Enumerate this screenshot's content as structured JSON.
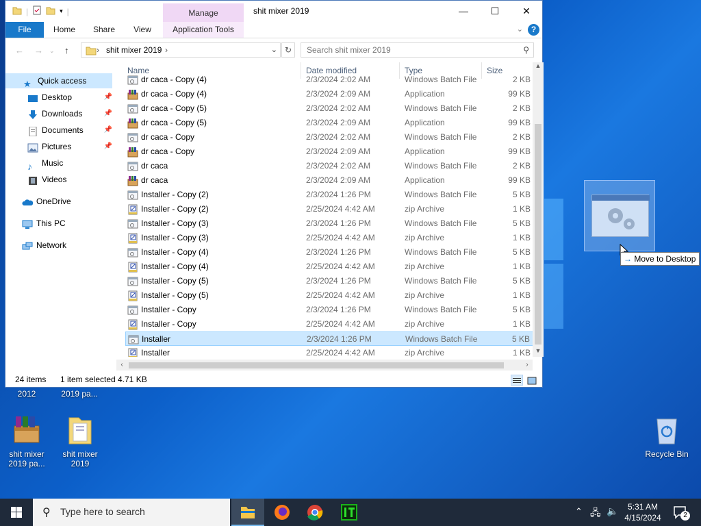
{
  "window": {
    "title": "shit mixer 2019",
    "context_tab": "Manage",
    "controls": {
      "minimize": "—",
      "maximize": "☐",
      "close": "✕"
    }
  },
  "ribbon": {
    "tabs": [
      "File",
      "Home",
      "Share",
      "View",
      "Application Tools"
    ],
    "help": "?"
  },
  "address": {
    "path": "shit mixer 2019",
    "search_placeholder": "Search shit mixer 2019"
  },
  "navpane": {
    "quick_access": "Quick access",
    "items": [
      "Desktop",
      "Downloads",
      "Documents",
      "Pictures",
      "Music",
      "Videos"
    ],
    "onedrive": "OneDrive",
    "thispc": "This PC",
    "network": "Network"
  },
  "columns": {
    "name": "Name",
    "date": "Date modified",
    "type": "Type",
    "size": "Size"
  },
  "files": [
    {
      "name": "dr caca - Copy (4)",
      "date": "2/3/2024 2:02 AM",
      "type": "Windows Batch File",
      "size": "2 KB",
      "icon": "batch-file-icon"
    },
    {
      "name": "dr caca - Copy (4)",
      "date": "2/3/2024 2:09 AM",
      "type": "Application",
      "size": "99 KB",
      "icon": "application-icon"
    },
    {
      "name": "dr caca - Copy (5)",
      "date": "2/3/2024 2:02 AM",
      "type": "Windows Batch File",
      "size": "2 KB",
      "icon": "batch-file-icon"
    },
    {
      "name": "dr caca - Copy (5)",
      "date": "2/3/2024 2:09 AM",
      "type": "Application",
      "size": "99 KB",
      "icon": "application-icon"
    },
    {
      "name": "dr caca - Copy",
      "date": "2/3/2024 2:02 AM",
      "type": "Windows Batch File",
      "size": "2 KB",
      "icon": "batch-file-icon"
    },
    {
      "name": "dr caca - Copy",
      "date": "2/3/2024 2:09 AM",
      "type": "Application",
      "size": "99 KB",
      "icon": "application-icon"
    },
    {
      "name": "dr caca",
      "date": "2/3/2024 2:02 AM",
      "type": "Windows Batch File",
      "size": "2 KB",
      "icon": "batch-file-icon"
    },
    {
      "name": "dr caca",
      "date": "2/3/2024 2:09 AM",
      "type": "Application",
      "size": "99 KB",
      "icon": "application-icon"
    },
    {
      "name": "Installer - Copy (2)",
      "date": "2/3/2024 1:26 PM",
      "type": "Windows Batch File",
      "size": "5 KB",
      "icon": "batch-file-icon"
    },
    {
      "name": "Installer - Copy (2)",
      "date": "2/25/2024 4:42 AM",
      "type": "zip Archive",
      "size": "1 KB",
      "icon": "zip-archive-icon"
    },
    {
      "name": "Installer - Copy (3)",
      "date": "2/3/2024 1:26 PM",
      "type": "Windows Batch File",
      "size": "5 KB",
      "icon": "batch-file-icon"
    },
    {
      "name": "Installer - Copy (3)",
      "date": "2/25/2024 4:42 AM",
      "type": "zip Archive",
      "size": "1 KB",
      "icon": "zip-archive-icon"
    },
    {
      "name": "Installer - Copy (4)",
      "date": "2/3/2024 1:26 PM",
      "type": "Windows Batch File",
      "size": "5 KB",
      "icon": "batch-file-icon"
    },
    {
      "name": "Installer - Copy (4)",
      "date": "2/25/2024 4:42 AM",
      "type": "zip Archive",
      "size": "1 KB",
      "icon": "zip-archive-icon"
    },
    {
      "name": "Installer - Copy (5)",
      "date": "2/3/2024 1:26 PM",
      "type": "Windows Batch File",
      "size": "5 KB",
      "icon": "batch-file-icon"
    },
    {
      "name": "Installer - Copy (5)",
      "date": "2/25/2024 4:42 AM",
      "type": "zip Archive",
      "size": "1 KB",
      "icon": "zip-archive-icon"
    },
    {
      "name": "Installer - Copy",
      "date": "2/3/2024 1:26 PM",
      "type": "Windows Batch File",
      "size": "5 KB",
      "icon": "batch-file-icon"
    },
    {
      "name": "Installer - Copy",
      "date": "2/25/2024 4:42 AM",
      "type": "zip Archive",
      "size": "1 KB",
      "icon": "zip-archive-icon"
    },
    {
      "name": "Installer",
      "date": "2/3/2024 1:26 PM",
      "type": "Windows Batch File",
      "size": "5 KB",
      "icon": "batch-file-icon",
      "selected": true
    },
    {
      "name": "Installer",
      "date": "2/25/2024 4:42 AM",
      "type": "zip Archive",
      "size": "1 KB",
      "icon": "zip-archive-icon"
    }
  ],
  "status": {
    "count": "24 items",
    "selected": "1 item selected",
    "size": "4.71 KB"
  },
  "desktop": {
    "partial_labels": [
      "2012",
      "2019 pa..."
    ],
    "icons": [
      {
        "label": "shit mixer 2019 pa...",
        "icon": "winrar-archive-icon"
      },
      {
        "label": "shit mixer 2019",
        "icon": "folder-icon"
      },
      {
        "label": "Recycle Bin",
        "icon": "recycle-bin-icon"
      }
    ],
    "drag_tooltip": "Move to Desktop"
  },
  "taskbar": {
    "search_placeholder": "Type here to search",
    "time": "5:31 AM",
    "date": "4/15/2024",
    "notification_count": "2"
  },
  "colors": {
    "accent": "#1979ca",
    "selection": "#cce8ff",
    "context_tab": "#f0d8f5",
    "taskbar": "#1f2a3a"
  }
}
